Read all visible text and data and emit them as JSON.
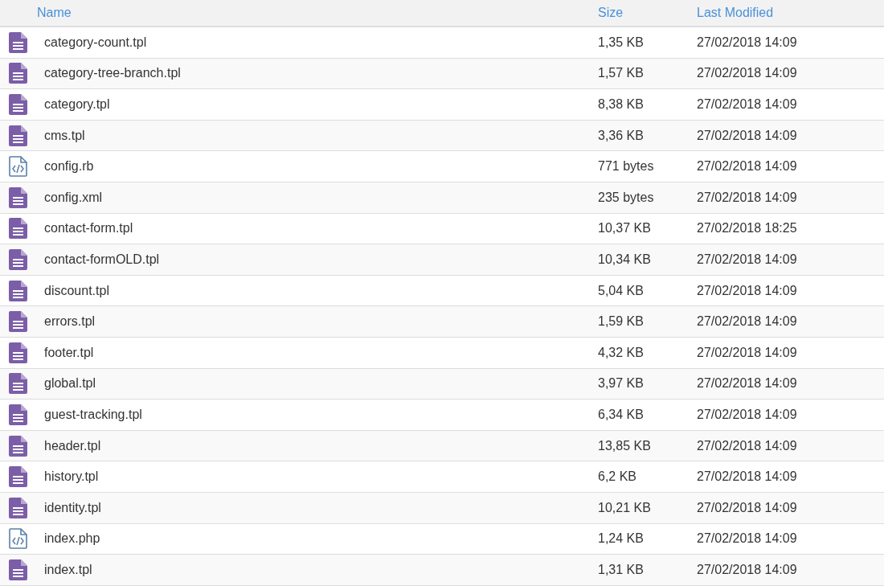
{
  "table": {
    "columns": [
      "Name",
      "Size",
      "Last Modified"
    ],
    "rows": [
      {
        "kind": "document",
        "name": "category-count.tpl",
        "size": "1,35 KB",
        "modified": "27/02/2018 14:09"
      },
      {
        "kind": "document",
        "name": "category-tree-branch.tpl",
        "size": "1,57 KB",
        "modified": "27/02/2018 14:09"
      },
      {
        "kind": "document",
        "name": "category.tpl",
        "size": "8,38 KB",
        "modified": "27/02/2018 14:09"
      },
      {
        "kind": "document",
        "name": "cms.tpl",
        "size": "3,36 KB",
        "modified": "27/02/2018 14:09"
      },
      {
        "kind": "code",
        "name": "config.rb",
        "size": "771 bytes",
        "modified": "27/02/2018 14:09"
      },
      {
        "kind": "document",
        "name": "config.xml",
        "size": "235 bytes",
        "modified": "27/02/2018 14:09"
      },
      {
        "kind": "document",
        "name": "contact-form.tpl",
        "size": "10,37 KB",
        "modified": "27/02/2018 18:25"
      },
      {
        "kind": "document",
        "name": "contact-formOLD.tpl",
        "size": "10,34 KB",
        "modified": "27/02/2018 14:09"
      },
      {
        "kind": "document",
        "name": "discount.tpl",
        "size": "5,04 KB",
        "modified": "27/02/2018 14:09"
      },
      {
        "kind": "document",
        "name": "errors.tpl",
        "size": "1,59 KB",
        "modified": "27/02/2018 14:09"
      },
      {
        "kind": "document",
        "name": "footer.tpl",
        "size": "4,32 KB",
        "modified": "27/02/2018 14:09"
      },
      {
        "kind": "document",
        "name": "global.tpl",
        "size": "3,97 KB",
        "modified": "27/02/2018 14:09"
      },
      {
        "kind": "document",
        "name": "guest-tracking.tpl",
        "size": "6,34 KB",
        "modified": "27/02/2018 14:09"
      },
      {
        "kind": "document",
        "name": "header.tpl",
        "size": "13,85 KB",
        "modified": "27/02/2018 14:09"
      },
      {
        "kind": "document",
        "name": "history.tpl",
        "size": "6,2 KB",
        "modified": "27/02/2018 14:09"
      },
      {
        "kind": "document",
        "name": "identity.tpl",
        "size": "10,21 KB",
        "modified": "27/02/2018 14:09"
      },
      {
        "kind": "code",
        "name": "index.php",
        "size": "1,24 KB",
        "modified": "27/02/2018 14:09"
      },
      {
        "kind": "document",
        "name": "index.tpl",
        "size": "1,31 KB",
        "modified": "27/02/2018 14:09"
      }
    ]
  }
}
